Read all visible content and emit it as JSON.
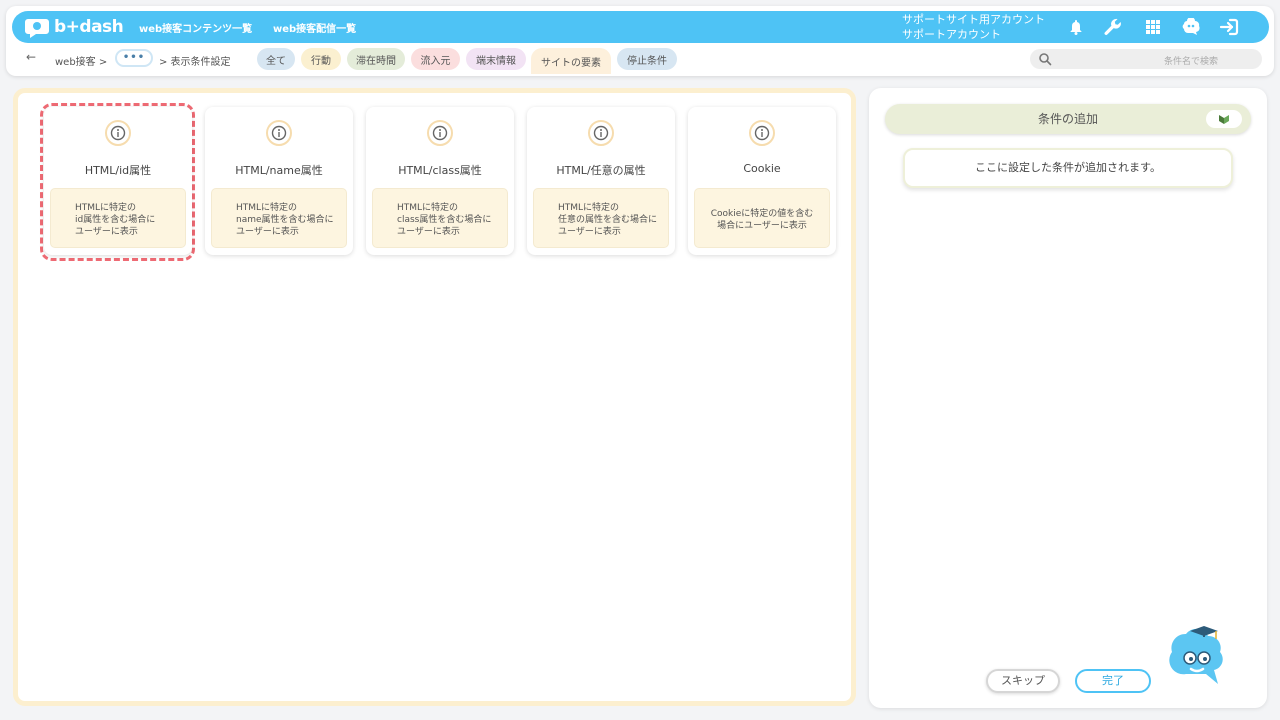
{
  "header": {
    "logo_text": "b+dash",
    "nav": [
      "web接客コンテンツ一覧",
      "web接客配信一覧"
    ],
    "account_line1": "サポートサイト用アカウント",
    "account_line2": "サポートアカウント",
    "icons": [
      "bell-icon",
      "wrench-icon",
      "grid-icon",
      "brain-icon",
      "logout-icon"
    ]
  },
  "breadcrumb": {
    "back": "←",
    "root": "web接客 >",
    "ellipsis": "•••",
    "current": "> 表示条件設定"
  },
  "filters": [
    {
      "label": "全て",
      "color": "#d7e6f2"
    },
    {
      "label": "行動",
      "color": "#fbf0d0"
    },
    {
      "label": "滞在時間",
      "color": "#e4ecd9"
    },
    {
      "label": "流入元",
      "color": "#fbdede"
    },
    {
      "label": "端末情報",
      "color": "#f2e3f4"
    },
    {
      "label": "サイトの要素",
      "color": "#fdf0dc"
    },
    {
      "label": "停止条件",
      "color": "#d7e6f2"
    }
  ],
  "search": {
    "placeholder": "条件名で検索"
  },
  "cards": [
    {
      "title": "HTML/id属性",
      "desc": [
        "HTMLに特定の",
        "id属性を含む場合に",
        "ユーザーに表示"
      ]
    },
    {
      "title": "HTML/name属性",
      "desc": [
        "HTMLに特定の",
        "name属性を含む場合に",
        "ユーザーに表示"
      ]
    },
    {
      "title": "HTML/class属性",
      "desc": [
        "HTMLに特定の",
        "class属性を含む場合に",
        "ユーザーに表示"
      ]
    },
    {
      "title": "HTML/任意の属性",
      "desc": [
        "HTMLに特定の",
        "任意の属性を含む場合に",
        "ユーザーに表示"
      ]
    },
    {
      "title": "Cookie",
      "desc": [
        "Cookieに特定の値を含む",
        "場合にユーザーに表示",
        ""
      ]
    }
  ],
  "conditions": {
    "title": "条件の追加",
    "placeholder": "ここに設定した条件が追加されます。"
  },
  "buttons": {
    "skip": "スキップ",
    "done": "完了"
  },
  "colors": {
    "accent": "#4ec3f5",
    "highlight": "#ef6b74",
    "panel_border": "#fcefcf"
  }
}
